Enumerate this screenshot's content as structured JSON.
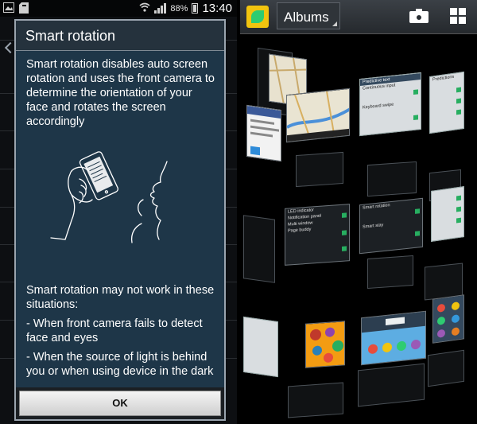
{
  "status_bar": {
    "battery_percent": "88%",
    "time": "13:40",
    "icons": [
      "image-icon",
      "sd-card-icon",
      "wifi-icon",
      "signal-icon",
      "battery-icon"
    ]
  },
  "dialog": {
    "title": "Smart rotation",
    "description": "Smart rotation disables auto screen rotation and uses the front camera to determine the orientation of your face and rotates the screen accordingly",
    "illustration_icon": "hand-holding-phone-face-illustration",
    "limitations_heading": "Smart rotation may not work in these situations:",
    "limitations": [
      "- When front camera fails to detect face and eyes",
      "- When the source of light is behind you or when using device in the dark"
    ],
    "ok_label": "OK"
  },
  "gallery": {
    "album_selector": "Albums",
    "icons": [
      "gallery-app-icon",
      "camera-icon",
      "grid-view-icon"
    ],
    "colors": {
      "accent": "#27ae60",
      "dialog_bg": "#1e3648"
    },
    "thumb_texts": [
      "Predictive text",
      "Continuous input",
      "Keyboard swipe",
      "LED indicator",
      "Notification panel",
      "Multi window",
      "Page buddy",
      "Smart rotation",
      "Smart stay",
      "Predictions"
    ]
  }
}
